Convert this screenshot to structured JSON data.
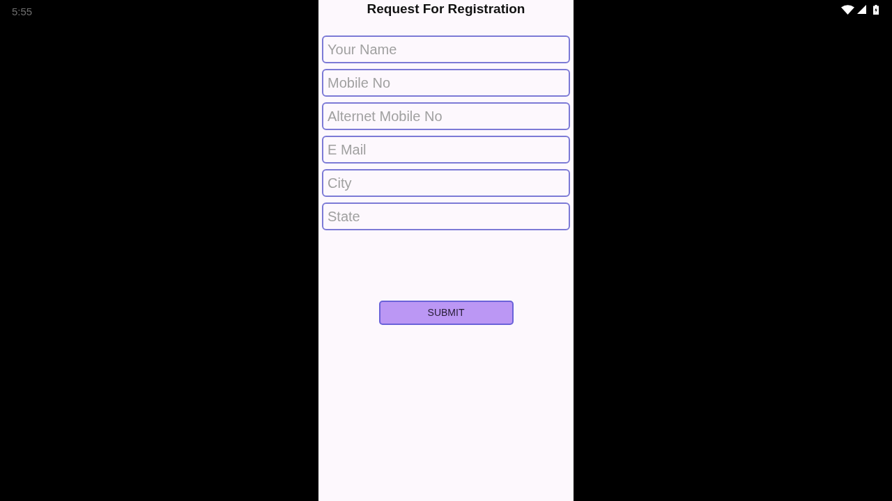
{
  "status_bar": {
    "time": "5:55"
  },
  "screen": {
    "title": "Request For Registration",
    "fields": [
      {
        "placeholder": "Your Name"
      },
      {
        "placeholder": "Mobile No"
      },
      {
        "placeholder": "Alternet Mobile No"
      },
      {
        "placeholder": "E Mail"
      },
      {
        "placeholder": "City"
      },
      {
        "placeholder": "State"
      }
    ],
    "submit_button": "SUBMIT"
  }
}
